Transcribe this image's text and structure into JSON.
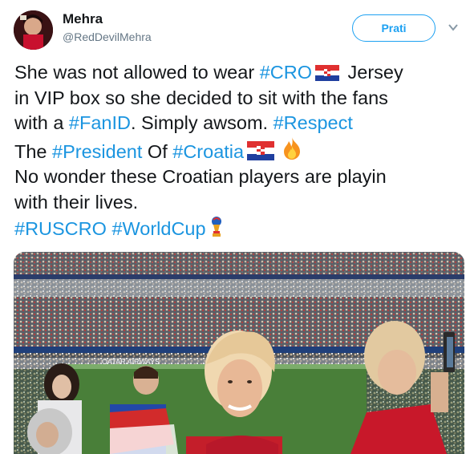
{
  "user": {
    "name": "Mehra",
    "handle": "@RedDevilMehra"
  },
  "follow_button": {
    "label": "Prati"
  },
  "tweet": {
    "l1_a": "She was not allowed to wear ",
    "l1_tag": "#CRO",
    "l1_b": " Jersey",
    "l2": "in VIP box so she decided to sit with the fans",
    "l3_a": "with a ",
    "l3_tag": "#FanID",
    "l3_b": ". Simply awsom. ",
    "l3_tag2": "#Respect",
    "l4_a": "The ",
    "l4_tag": "#President",
    "l4_b": " Of ",
    "l4_tag2": "#Croatia",
    "l5": "No wonder these Croatian players are playin",
    "l6": "with their lives.",
    "l7_tag": "#RUSCRO",
    "l7_sp": " ",
    "l7_tag2": "#WorldCup"
  },
  "media": {
    "banner_text": "QATAR AIRWAYS"
  },
  "colors": {
    "link": "#1b95e0",
    "follow": "#1da1f2",
    "handle": "#657786"
  },
  "icons": [
    "croatia-flag-icon",
    "fire-icon",
    "world-cup-trophy-icon",
    "chevron-down-icon"
  ]
}
